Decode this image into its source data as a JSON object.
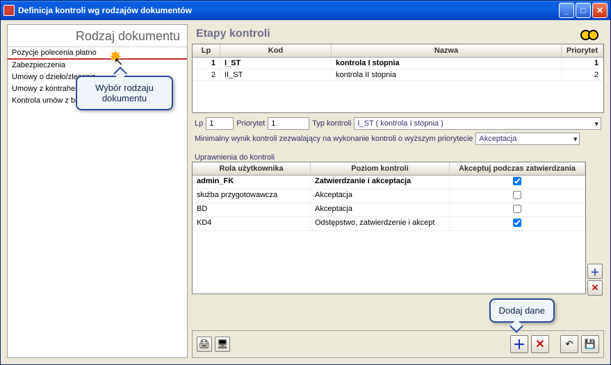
{
  "window": {
    "title": "Definicja kontroli wg rodzajów dokumentów"
  },
  "left": {
    "title": "Rodzaj dokumentu",
    "items": [
      "Pozycje polecenia płatno",
      "Zabezpieczenia",
      "Umowy o dzieło/zlecenia",
      "Umowy z kontrahen",
      "Kontrola umów z be"
    ]
  },
  "right": {
    "title": "Etapy kontroli",
    "stages": {
      "headers": {
        "lp": "Lp",
        "kod": "Kod",
        "nazwa": "Nazwa",
        "pri": "Priorytet"
      },
      "rows": [
        {
          "lp": "1",
          "kod": "I_ST",
          "nazwa": "kontrola I stopnia",
          "pri": "1"
        },
        {
          "lp": "2",
          "kod": "II_ST",
          "nazwa": "kontrola II stopnia",
          "pri": "2"
        }
      ]
    },
    "fields": {
      "lp_label": "Lp",
      "lp_value": "1",
      "pri_label": "Priorytet",
      "pri_value": "1",
      "type_label": "Typ kontroli",
      "type_value": "I_ST ( kontrola I stopnia )",
      "min_label": "Minimalny wynik kontroli zezwalający na wykonanie kontroli o wyższym priorytecie",
      "min_value": "Akceptacja"
    },
    "perm_label": "Uprawnienia do kontroli",
    "perm": {
      "headers": {
        "role": "Rola użytkownika",
        "level": "Poziom kontroli",
        "accept": "Akceptuj podczas zatwierdzania"
      },
      "rows": [
        {
          "role": "admin_FK",
          "level": "Zatwierdzanie i akceptacja",
          "accept": true
        },
        {
          "role": "służba przygotowawcza",
          "level": "Akceptacja",
          "accept": false
        },
        {
          "role": "BD",
          "level": "Akceptacja",
          "accept": false
        },
        {
          "role": "KD4",
          "level": "Odstępstwo, zatwierdzenie i akcept",
          "accept": true
        }
      ]
    }
  },
  "callouts": {
    "c1": "Wybór rodzaju dokumentu",
    "c2": "Dodaj dane"
  },
  "icons": {
    "plus": "＋",
    "x": "✕",
    "undo": "↶",
    "save": "💾",
    "print": "🖨",
    "screen": "🖥"
  }
}
